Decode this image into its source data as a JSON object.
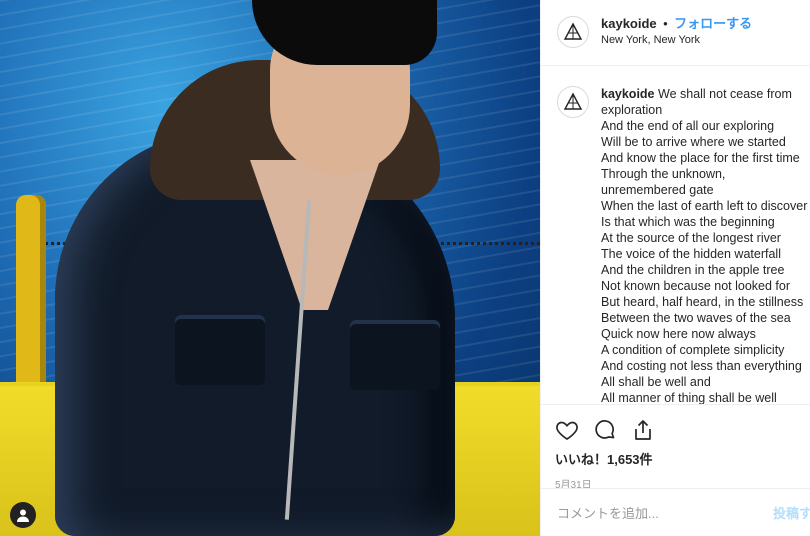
{
  "post": {
    "username": "kaykoide",
    "separator": "•",
    "follow_label": "フォローする",
    "location": "New York, New York"
  },
  "caption": {
    "username": "kaykoide",
    "lines": [
      "We shall not cease from",
      "exploration",
      "And the end of all our exploring",
      "Will be to arrive where we started",
      "And know the place for the first time",
      "Through the unknown,",
      "unremembered gate",
      "When the last of earth left to discover",
      "Is that which was the beginning",
      "At the source of the longest river",
      "The voice of the hidden waterfall",
      "And the children in the apple tree",
      "Not known because not looked for",
      "But heard, half heard, in the stillness",
      "Between the two waves of the sea",
      "Quick now here now always",
      "A condition of complete simplicity",
      "And costing not less than everything",
      "All shall be well and",
      "All manner of thing shall be well"
    ]
  },
  "actions": {
    "likes_text": "いいね！1,653件",
    "date": "5月31日",
    "comment_placeholder": "コメントを追加...",
    "post_label": "投稿する"
  },
  "icons": {
    "like": "heart-icon",
    "comment": "comment-icon",
    "share": "share-icon",
    "profile_avatar": "triangle-logo-icon",
    "photo_user_tag": "user-tag-icon"
  },
  "colors": {
    "follow": "#3897f0",
    "text": "#262626",
    "muted": "#999999",
    "post_button_disabled": "#b2dffc"
  }
}
